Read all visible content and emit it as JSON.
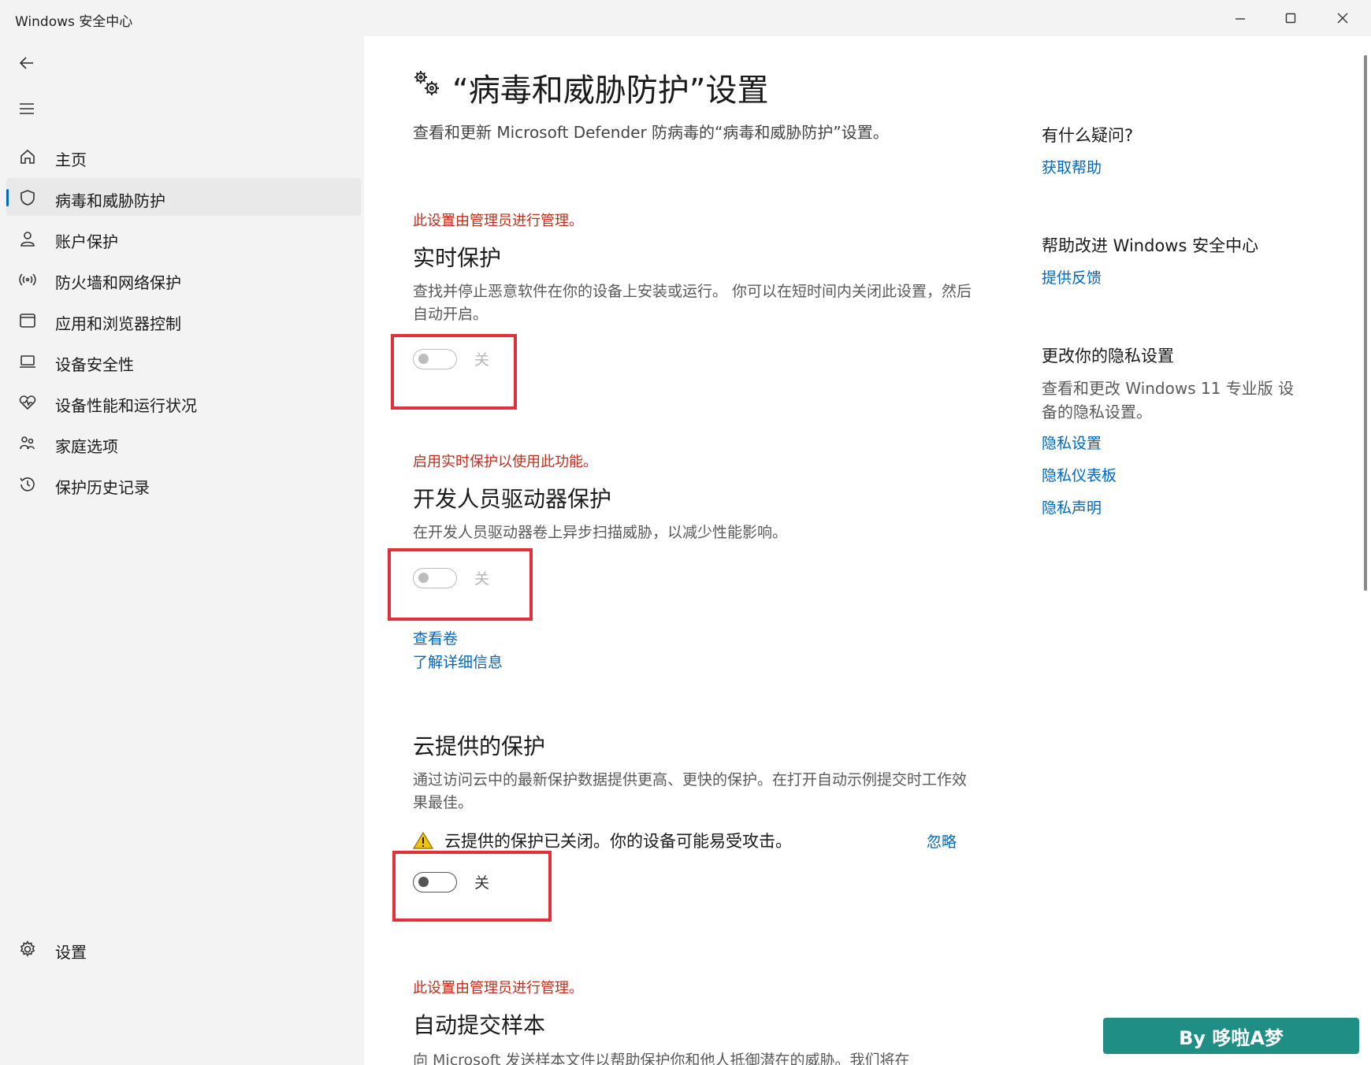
{
  "window": {
    "title": "Windows 安全中心"
  },
  "sidebar": {
    "items": [
      {
        "label": "主页",
        "icon": "home-icon"
      },
      {
        "label": "病毒和威胁防护",
        "icon": "shield-icon",
        "active": true
      },
      {
        "label": "账户保护",
        "icon": "person-icon"
      },
      {
        "label": "防火墙和网络保护",
        "icon": "antenna-icon"
      },
      {
        "label": "应用和浏览器控制",
        "icon": "app-window-icon"
      },
      {
        "label": "设备安全性",
        "icon": "laptop-icon"
      },
      {
        "label": "设备性能和运行状况",
        "icon": "heart-pulse-icon"
      },
      {
        "label": "家庭选项",
        "icon": "family-icon"
      },
      {
        "label": "保护历史记录",
        "icon": "history-icon"
      }
    ],
    "settings_label": "设置"
  },
  "main": {
    "title": "“病毒和威胁防护”设置",
    "subtitle": "查看和更新 Microsoft Defender 防病毒的“病毒和威胁防护”设置。",
    "realtime": {
      "managed_note": "此设置由管理员进行管理。",
      "title": "实时保护",
      "desc": "查找并停止恶意软件在你的设备上安装或运行。 你可以在短时间内关闭此设置，然后自动开启。",
      "toggle_label": "关",
      "toggle_on": false
    },
    "devdrive": {
      "note": "启用实时保护以使用此功能。",
      "title": "开发人员驱动器保护",
      "desc": "在开发人员驱动器卷上异步扫描威胁，以减少性能影响。",
      "toggle_label": "关",
      "toggle_on": false,
      "link_volumes": "查看卷",
      "link_learn": "了解详细信息"
    },
    "cloud": {
      "title": "云提供的保护",
      "desc": "通过访问云中的最新保护数据提供更高、更快的保护。在打开自动示例提交时工作效果最佳。",
      "alert": "云提供的保护已关闭。你的设备可能易受攻击。",
      "ignore": "忽略",
      "toggle_label": "关",
      "toggle_on": false
    },
    "sample": {
      "managed_note": "此设置由管理员进行管理。",
      "title": "自动提交样本",
      "desc": "向 Microsoft 发送样本文件以帮助保护你和他人抵御潜在的威胁。我们将在"
    }
  },
  "right": {
    "help_head": "有什么疑问?",
    "help_link": "获取帮助",
    "improve_head": "帮助改进 Windows 安全中心",
    "improve_link": "提供反馈",
    "privacy_head": "更改你的隐私设置",
    "privacy_text": "查看和更改 Windows 11 专业版 设备的隐私设置。",
    "privacy_links": [
      "隐私设置",
      "隐私仪表板",
      "隐私声明"
    ]
  },
  "watermark": "By 哆啦A梦",
  "colors": {
    "accent": "#0067c0",
    "warning_text": "#c42b1c",
    "highlight_box": "#e0303a",
    "watermark_bg": "#1f8e85"
  }
}
